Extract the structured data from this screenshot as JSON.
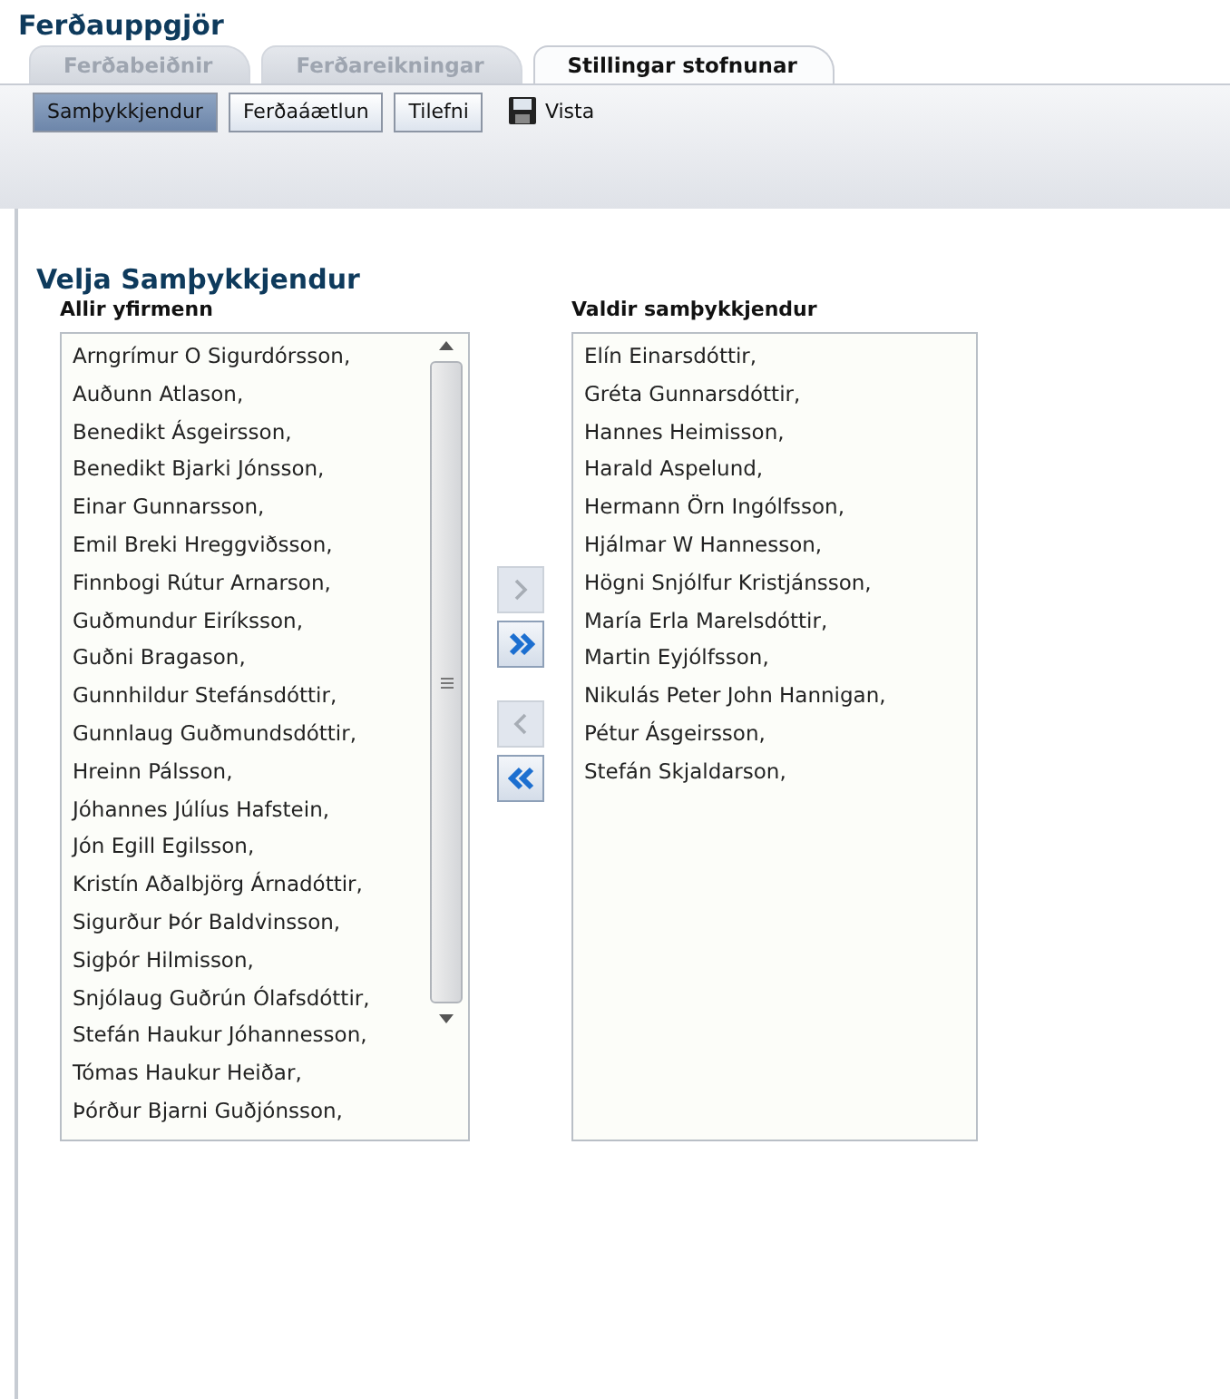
{
  "app_title": "Ferðauppgjör",
  "tabs": [
    {
      "label": "Ferðabeiðnir",
      "selected": false
    },
    {
      "label": "Ferðareikningar",
      "selected": false
    },
    {
      "label": "Stillingar stofnunar",
      "selected": true
    }
  ],
  "subtabs": [
    {
      "label": "Samþykkjendur",
      "selected": true
    },
    {
      "label": "Ferðaáætlun",
      "selected": false
    },
    {
      "label": "Tilefni",
      "selected": false
    }
  ],
  "save_button": {
    "label": "Vista"
  },
  "section_title": "Velja Samþykkjendur",
  "all_list": {
    "heading": "Allir yfirmenn",
    "items": [
      "Arngrímur O Sigurdórsson,",
      "Auðunn Atlason,",
      "Benedikt Ásgeirsson,",
      "Benedikt Bjarki Jónsson,",
      "Einar Gunnarsson,",
      "Emil Breki Hreggviðsson,",
      "Finnbogi Rútur Arnarson,",
      "Guðmundur Eiríksson,",
      "Guðni Bragason,",
      "Gunnhildur Stefánsdóttir,",
      "Gunnlaug Guðmundsdóttir,",
      "Hreinn Pálsson,",
      "Jóhannes Júlíus Hafstein,",
      "Jón Egill Egilsson,",
      "Kristín Aðalbjörg Árnadóttir,",
      "Sigurður Þór Baldvinsson,",
      "Sigþór Hilmisson,",
      "Snjólaug Guðrún Ólafsdóttir,",
      "Stefán Haukur Jóhannesson,",
      "Tómas Haukur Heiðar,",
      "Þórður Bjarni Guðjónsson,"
    ]
  },
  "move_buttons": [
    {
      "kind": "right",
      "disabled": true
    },
    {
      "kind": "all-right",
      "disabled": false
    },
    {
      "kind": "left",
      "disabled": true
    },
    {
      "kind": "all-left",
      "disabled": false
    }
  ],
  "selected_list": {
    "heading": "Valdir samþykkjendur",
    "items": [
      "Elín Einarsdóttir,",
      "Gréta Gunnarsdóttir,",
      "Hannes Heimisson,",
      "Harald Aspelund,",
      "Hermann Örn Ingólfsson,",
      "Hjálmar W Hannesson,",
      "Högni Snjólfur Kristjánsson,",
      "María Erla Marelsdóttir,",
      "Martin Eyjólfsson,",
      "Nikulás Peter John Hannigan,",
      "Pétur Ásgeirsson,",
      "Stefán Skjaldarson,"
    ]
  }
}
